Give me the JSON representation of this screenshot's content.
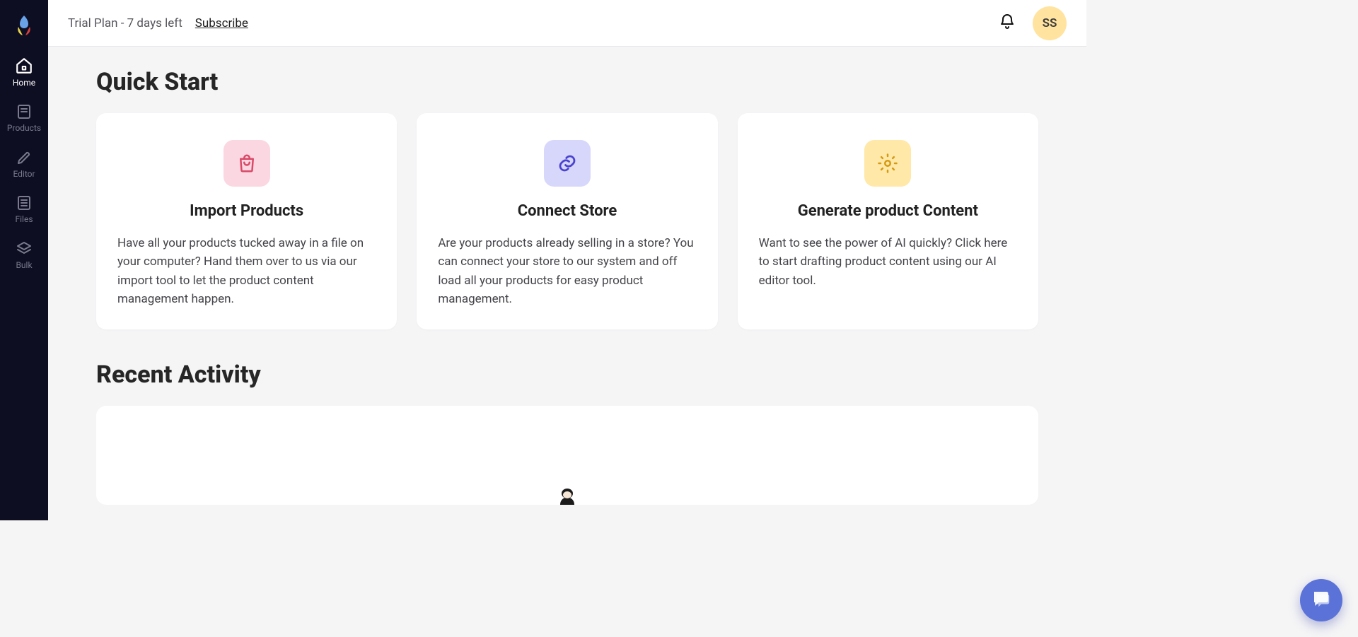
{
  "sidebar": {
    "items": [
      {
        "label": "Home"
      },
      {
        "label": "Products"
      },
      {
        "label": "Editor"
      },
      {
        "label": "Files"
      },
      {
        "label": "Bulk"
      }
    ]
  },
  "topbar": {
    "trial_text": "Trial Plan - 7 days left",
    "subscribe_label": "Subscribe",
    "avatar_initials": "SS"
  },
  "quickstart": {
    "title": "Quick Start",
    "cards": [
      {
        "title": "Import Products",
        "desc": "Have all your products tucked away in a file on your computer? Hand them over to us via our import tool to let the product content management happen."
      },
      {
        "title": "Connect Store",
        "desc": "Are your products already selling in a store? You can connect your store to our system and off load all your products for easy product management."
      },
      {
        "title": "Generate product Content",
        "desc": "Want to see the power of AI quickly? Click here to start drafting product content using our AI editor tool."
      }
    ]
  },
  "recent": {
    "title": "Recent Activity"
  }
}
